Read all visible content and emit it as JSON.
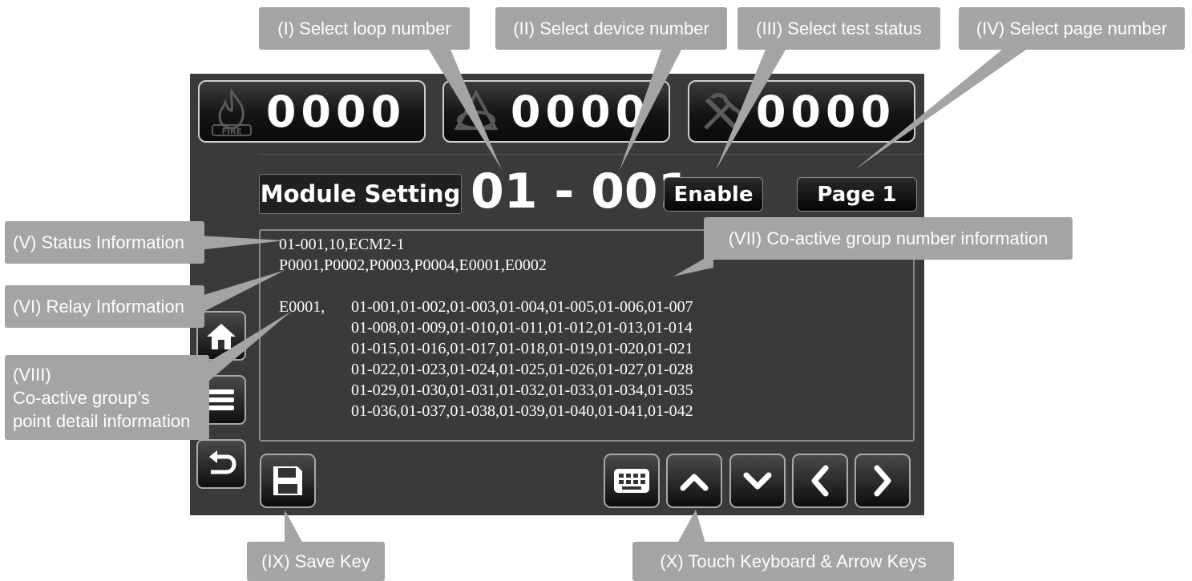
{
  "counters": {
    "fire": {
      "value": "0000",
      "icon": "fire-icon",
      "icon_text": "FIRE"
    },
    "supervisory": {
      "value": "0000",
      "icon": "warning-shield-icon"
    },
    "trouble": {
      "value": "0000",
      "icon": "tools-icon"
    }
  },
  "header": {
    "title": "Module Setting",
    "loop": "01",
    "dash": "-",
    "device": "001",
    "status_button": "Enable",
    "page_button": "Page 1"
  },
  "info": {
    "status_line": "01-001,10,ECM2-1",
    "relay_line": "P0001,P0002,P0003,P0004,E0001,E0002",
    "group_label": "E0001,",
    "group_rows": [
      "01-001,01-002,01-003,01-004,01-005,01-006,01-007",
      "01-008,01-009,01-010,01-011,01-012,01-013,01-014",
      "01-015,01-016,01-017,01-018,01-019,01-020,01-021",
      "01-022,01-023,01-024,01-025,01-026,01-027,01-028",
      "01-029,01-030,01-031,01-032,01-033,01-034,01-035",
      "01-036,01-037,01-038,01-039,01-040,01-041,01-042"
    ]
  },
  "side_buttons": [
    "home-icon",
    "menu-icon",
    "back-icon"
  ],
  "bottom_buttons": [
    "save-icon",
    "keyboard-icon",
    "arrow-up-icon",
    "arrow-down-icon",
    "arrow-left-icon",
    "arrow-right-icon"
  ],
  "callouts": {
    "loop": "(I) Select loop number",
    "device": "(II) Select device number",
    "status": "(III) Select test status",
    "page": "(IV) Select page number",
    "status_info": "(V) Status Information",
    "relay_info": "(VI) Relay Information",
    "coactive_group": "(VII) Co-active group number information",
    "point_detail_1": "(VIII)",
    "point_detail_2": "Co-active group’s",
    "point_detail_3": "point detail information",
    "save": "(IX) Save Key",
    "keys": "(X) Touch Keyboard & Arrow Keys"
  },
  "colors": {
    "screen_bg": "#3a3a3a",
    "callout_bg": "#a4a4a4",
    "text": "#ffffff"
  }
}
